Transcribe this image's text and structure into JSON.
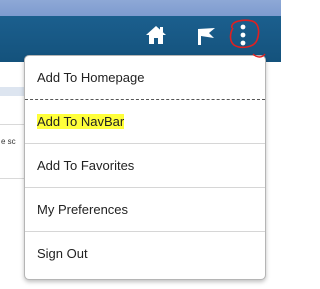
{
  "header": {
    "icons": [
      "home-icon",
      "flag-icon",
      "more-actions-icon"
    ],
    "accent": "#1b5f8e",
    "annotation_color": "#e02020"
  },
  "background": {
    "partial_text": "e sc"
  },
  "menu": {
    "items": [
      {
        "label": "Add To Homepage",
        "highlighted": false
      },
      {
        "label": "Add To NavBar",
        "highlighted": true,
        "highlight_color": "#ffff3a"
      },
      {
        "label": "Add To Favorites",
        "highlighted": false
      },
      {
        "label": "My Preferences",
        "highlighted": false
      },
      {
        "label": "Sign Out",
        "highlighted": false
      }
    ]
  }
}
